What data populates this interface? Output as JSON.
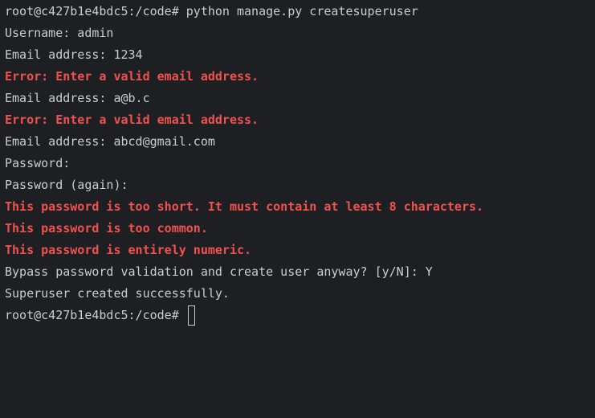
{
  "terminal": {
    "lines": [
      {
        "text": "root@c427b1e4bdc5:/code# python manage.py createsuperuser",
        "kind": "normal"
      },
      {
        "text": "Username: admin",
        "kind": "normal"
      },
      {
        "text": "Email address: 1234",
        "kind": "normal"
      },
      {
        "text": "Error: Enter a valid email address.",
        "kind": "error"
      },
      {
        "text": "Email address: a@b.c",
        "kind": "normal"
      },
      {
        "text": "Error: Enter a valid email address.",
        "kind": "error"
      },
      {
        "text": "Email address: abcd@gmail.com",
        "kind": "normal"
      },
      {
        "text": "Password:",
        "kind": "normal"
      },
      {
        "text": "Password (again):",
        "kind": "normal"
      },
      {
        "text": "This password is too short. It must contain at least 8 characters.",
        "kind": "error"
      },
      {
        "text": "This password is too common.",
        "kind": "error"
      },
      {
        "text": "This password is entirely numeric.",
        "kind": "error"
      },
      {
        "text": "Bypass password validation and create user anyway? [y/N]: Y",
        "kind": "normal"
      },
      {
        "text": "Superuser created successfully.",
        "kind": "normal"
      }
    ],
    "prompt": "root@c427b1e4bdc5:/code# "
  },
  "colors": {
    "background": "#1e1f22",
    "text": "#c9cdd3",
    "error": "#f0524f"
  }
}
